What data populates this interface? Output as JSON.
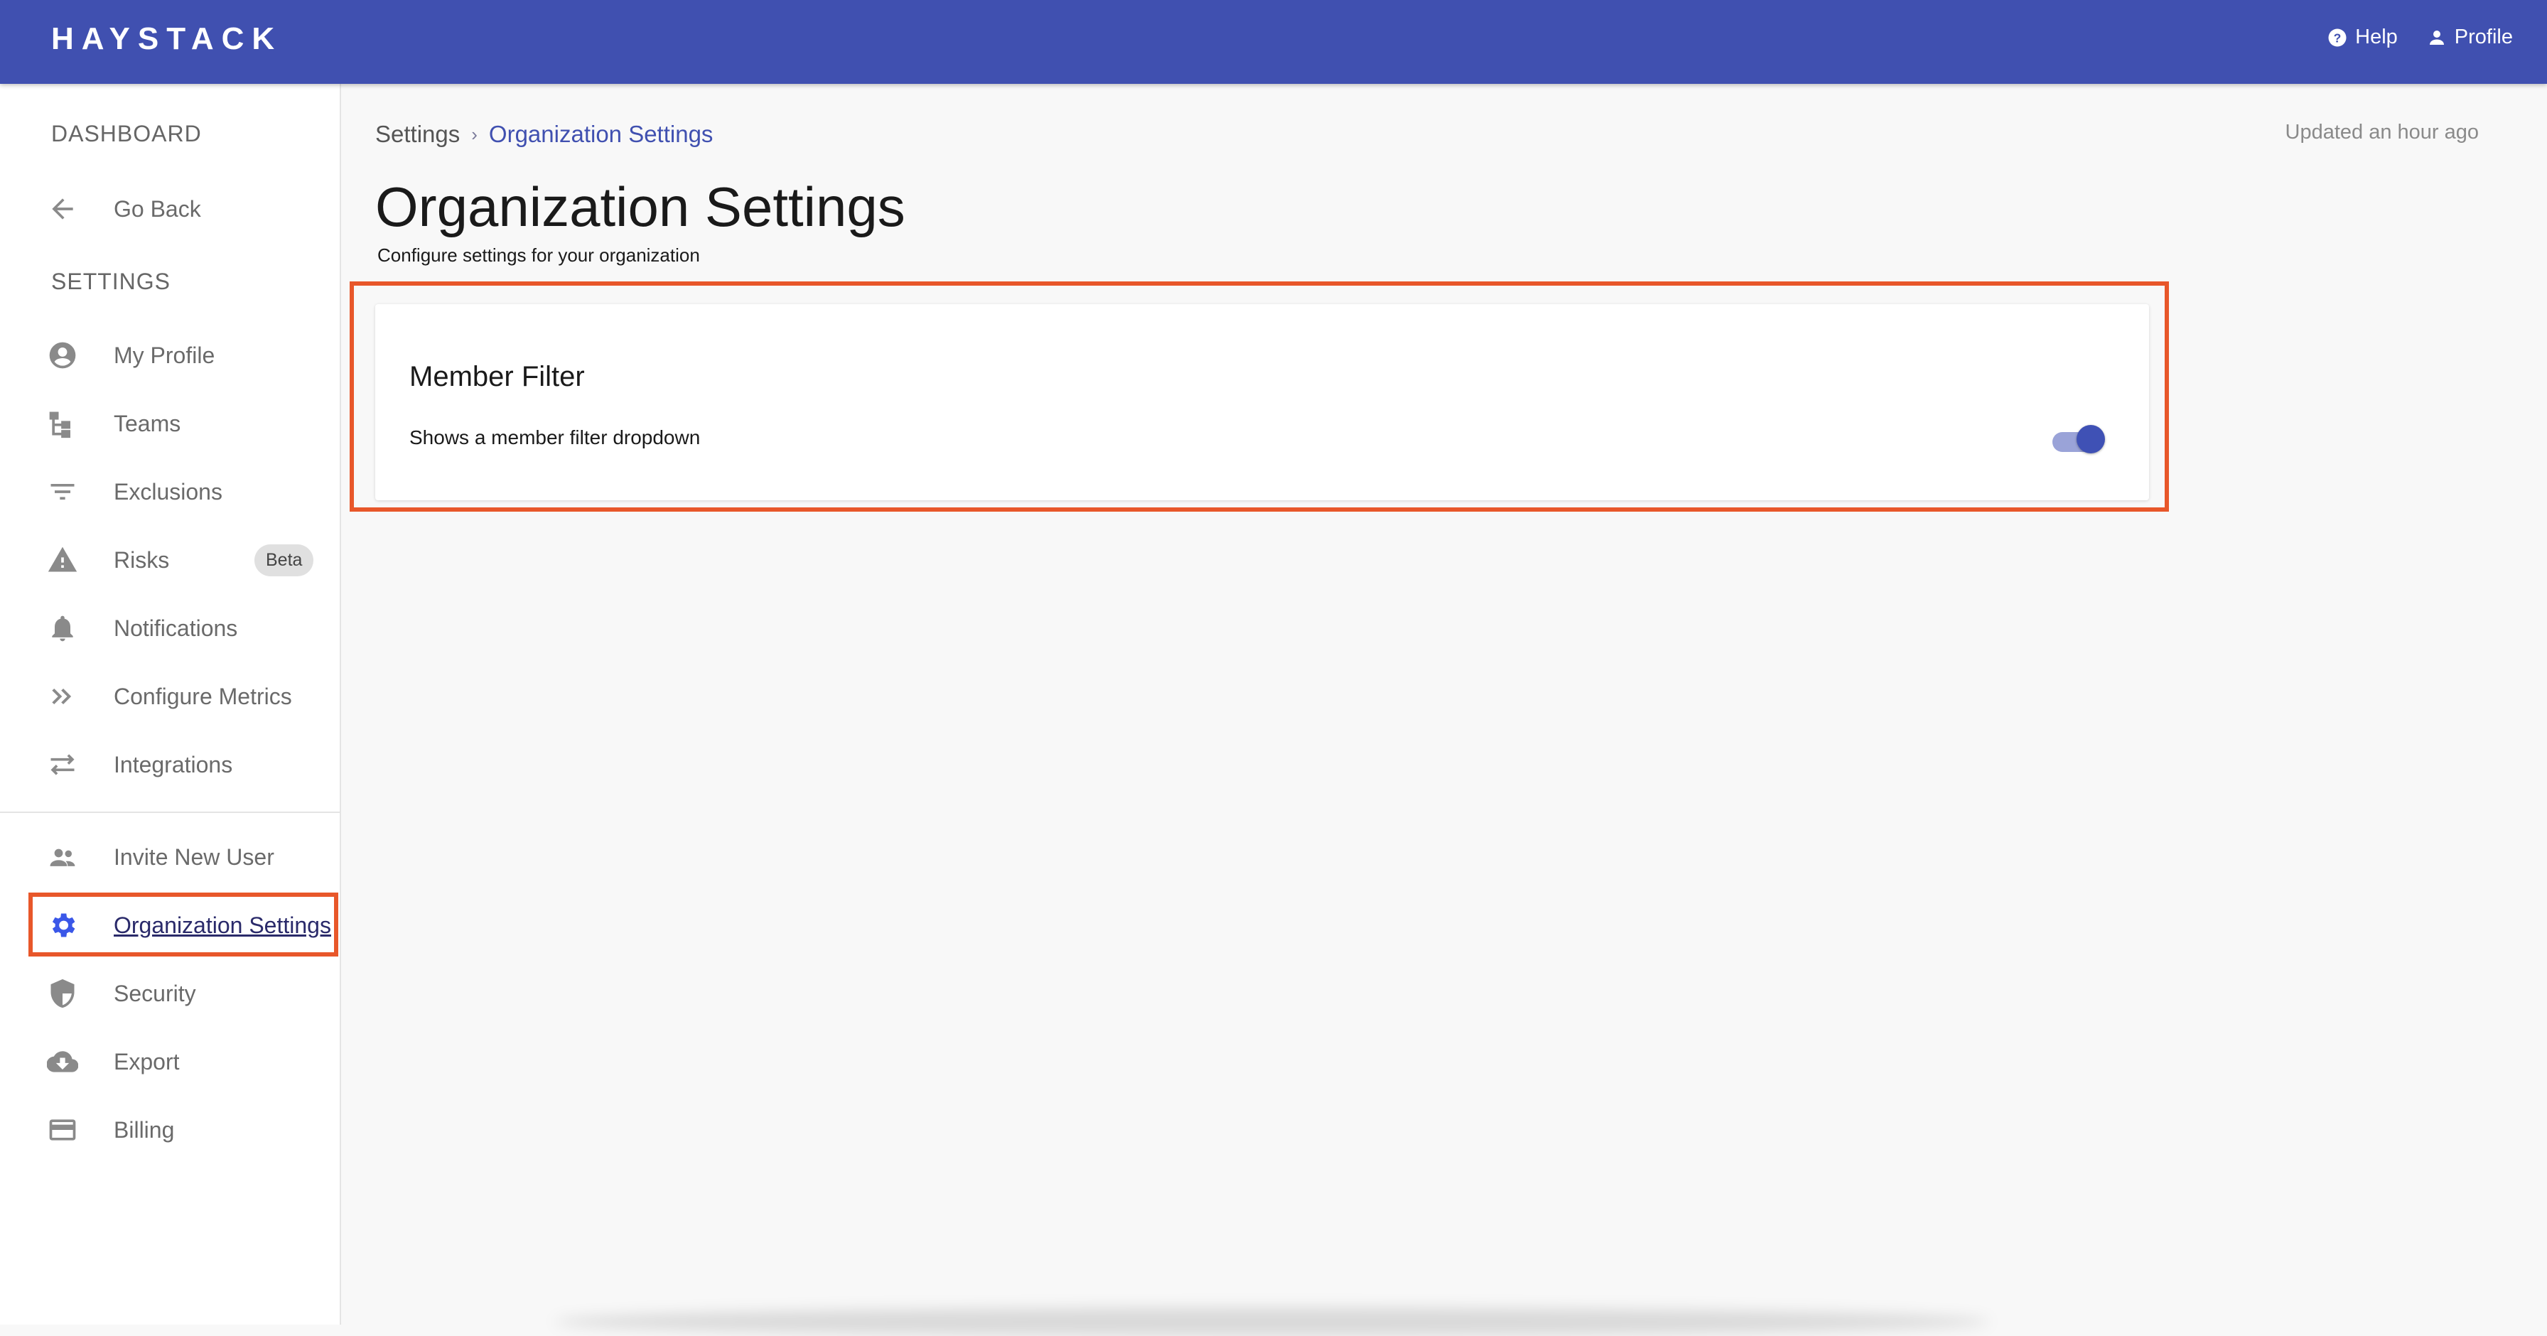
{
  "header": {
    "logo": "HAYSTACK",
    "help_label": "Help",
    "profile_label": "Profile"
  },
  "sidebar": {
    "dashboard_header": "DASHBOARD",
    "go_back": "Go Back",
    "settings_header": "SETTINGS",
    "items": [
      {
        "label": "My Profile",
        "icon": "account-circle-icon"
      },
      {
        "label": "Teams",
        "icon": "teams-icon"
      },
      {
        "label": "Exclusions",
        "icon": "filter-icon"
      },
      {
        "label": "Risks",
        "icon": "warning-icon",
        "badge": "Beta"
      },
      {
        "label": "Notifications",
        "icon": "bell-icon"
      },
      {
        "label": "Configure Metrics",
        "icon": "double-chevron-icon"
      },
      {
        "label": "Integrations",
        "icon": "swap-icon"
      }
    ],
    "lower_items": [
      {
        "label": "Invite New User",
        "icon": "people-icon"
      },
      {
        "label": "Organization Settings",
        "icon": "gear-icon",
        "active": true
      },
      {
        "label": "Security",
        "icon": "shield-icon"
      },
      {
        "label": "Export",
        "icon": "cloud-download-icon"
      },
      {
        "label": "Billing",
        "icon": "credit-card-icon"
      }
    ]
  },
  "main": {
    "breadcrumb": {
      "root": "Settings",
      "separator": "›",
      "current": "Organization Settings"
    },
    "updated": "Updated an hour ago",
    "title": "Organization Settings",
    "subtitle": "Configure settings for your organization",
    "card": {
      "title": "Member Filter",
      "description": "Shows a member filter dropdown",
      "toggle_on": true
    }
  },
  "colors": {
    "header_bg": "#4050b0",
    "accent": "#3f51b5",
    "highlight_outline": "#e8572a",
    "active_icon": "#3a57e8"
  }
}
